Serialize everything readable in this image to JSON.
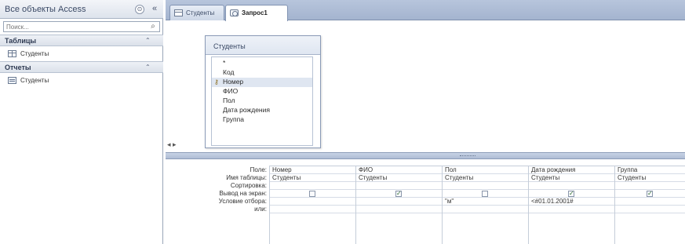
{
  "nav": {
    "title": "Все объекты Access",
    "menu_icon": "⊙",
    "collapse_icon": "«",
    "search_placeholder": "Поиск...",
    "search_icon": "⌕",
    "groups": [
      {
        "label": "Таблицы",
        "chevron": "⌃",
        "items": [
          {
            "label": "Студенты",
            "icon": "table-icon"
          }
        ]
      },
      {
        "label": "Отчеты",
        "chevron": "⌃",
        "items": [
          {
            "label": "Студенты",
            "icon": "report-icon"
          }
        ]
      }
    ]
  },
  "tabs": [
    {
      "label": "Студенты",
      "icon": "table-icon",
      "active": false
    },
    {
      "label": "Запрос1",
      "icon": "query-icon",
      "active": true
    }
  ],
  "table_box": {
    "title": "Студенты",
    "fields": [
      "*",
      "Код",
      "Номер",
      "ФИО",
      "Пол",
      "Дата рождения",
      "Группа"
    ],
    "key_field": "Номер",
    "key_icon": "⚷"
  },
  "scroll": {
    "left_arrows": "◂ ▸"
  },
  "qbe": {
    "row_labels": [
      "Поле:",
      "Имя таблицы:",
      "Сортировка:",
      "Вывод на экран:",
      "Условие отбора:",
      "или:"
    ],
    "columns": [
      {
        "field": "Номер",
        "table": "Студенты",
        "sort": "",
        "show": false,
        "criteria": "",
        "or": ""
      },
      {
        "field": "ФИО",
        "table": "Студенты",
        "sort": "",
        "show": true,
        "criteria": "",
        "or": ""
      },
      {
        "field": "Пол",
        "table": "Студенты",
        "sort": "",
        "show": false,
        "criteria": "\"м\"",
        "or": ""
      },
      {
        "field": "Дата рождения",
        "table": "Студенты",
        "sort": "",
        "show": true,
        "criteria": "<#01.01.2001#",
        "or": ""
      },
      {
        "field": "Группа",
        "table": "Студенты",
        "sort": "",
        "show": true,
        "criteria": "",
        "or": ""
      }
    ]
  }
}
